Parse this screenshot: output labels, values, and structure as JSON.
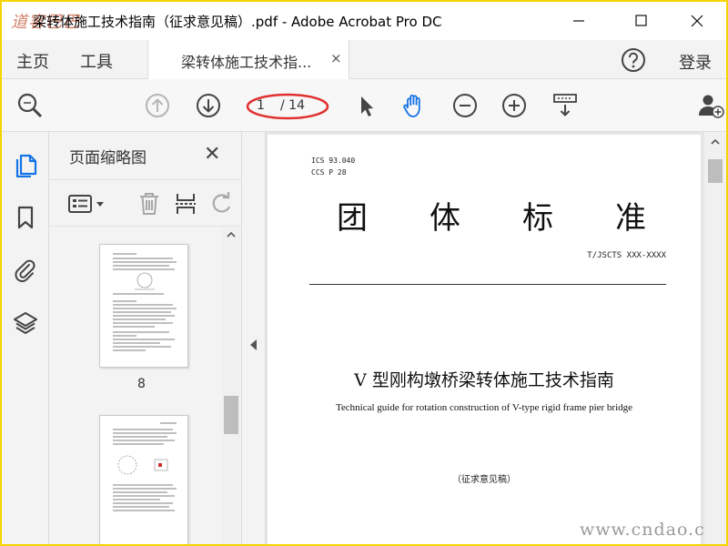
{
  "app": {
    "logo_text": "道客巴巴",
    "window_title": "梁转体施工技术指南（征求意见稿）.pdf - Adobe Acrobat Pro DC"
  },
  "tabs": {
    "home": "主页",
    "tools": "工具",
    "document": "梁转体施工技术指...",
    "close": "×",
    "login": "登录"
  },
  "toolbar": {
    "current_page": "1",
    "total_pages": "/ 14",
    "highlight_color": "#e03030",
    "accent_color": "#1473e6",
    "icons": [
      "zoom-search-icon",
      "page-up-icon",
      "page-down-icon",
      "select-cursor-icon",
      "hand-tool-icon",
      "zoom-out-icon",
      "zoom-in-icon",
      "keyboard-scroll-icon",
      "add-user-icon"
    ]
  },
  "rail": {
    "icons": [
      "page-thumbnails-icon",
      "bookmark-icon",
      "attachment-icon",
      "layers-icon"
    ]
  },
  "thumbnails": {
    "title": "页面缩略图",
    "close": "✕",
    "pages": [
      {
        "label": "8"
      },
      {
        "label": ""
      }
    ]
  },
  "document": {
    "ics": "ICS 93.040",
    "ccs": "CCS P 28",
    "std_title": [
      "团",
      "体",
      "标",
      "准"
    ],
    "std_number": "T/JSCTS XXX-XXXX",
    "cn_title": "V 型刚构墩桥梁转体施工技术指南",
    "en_title": "Technical guide for rotation construction of V-type rigid frame pier bridge",
    "draft_note": "（征求意见稿）"
  },
  "watermark": "www.cndao.com"
}
